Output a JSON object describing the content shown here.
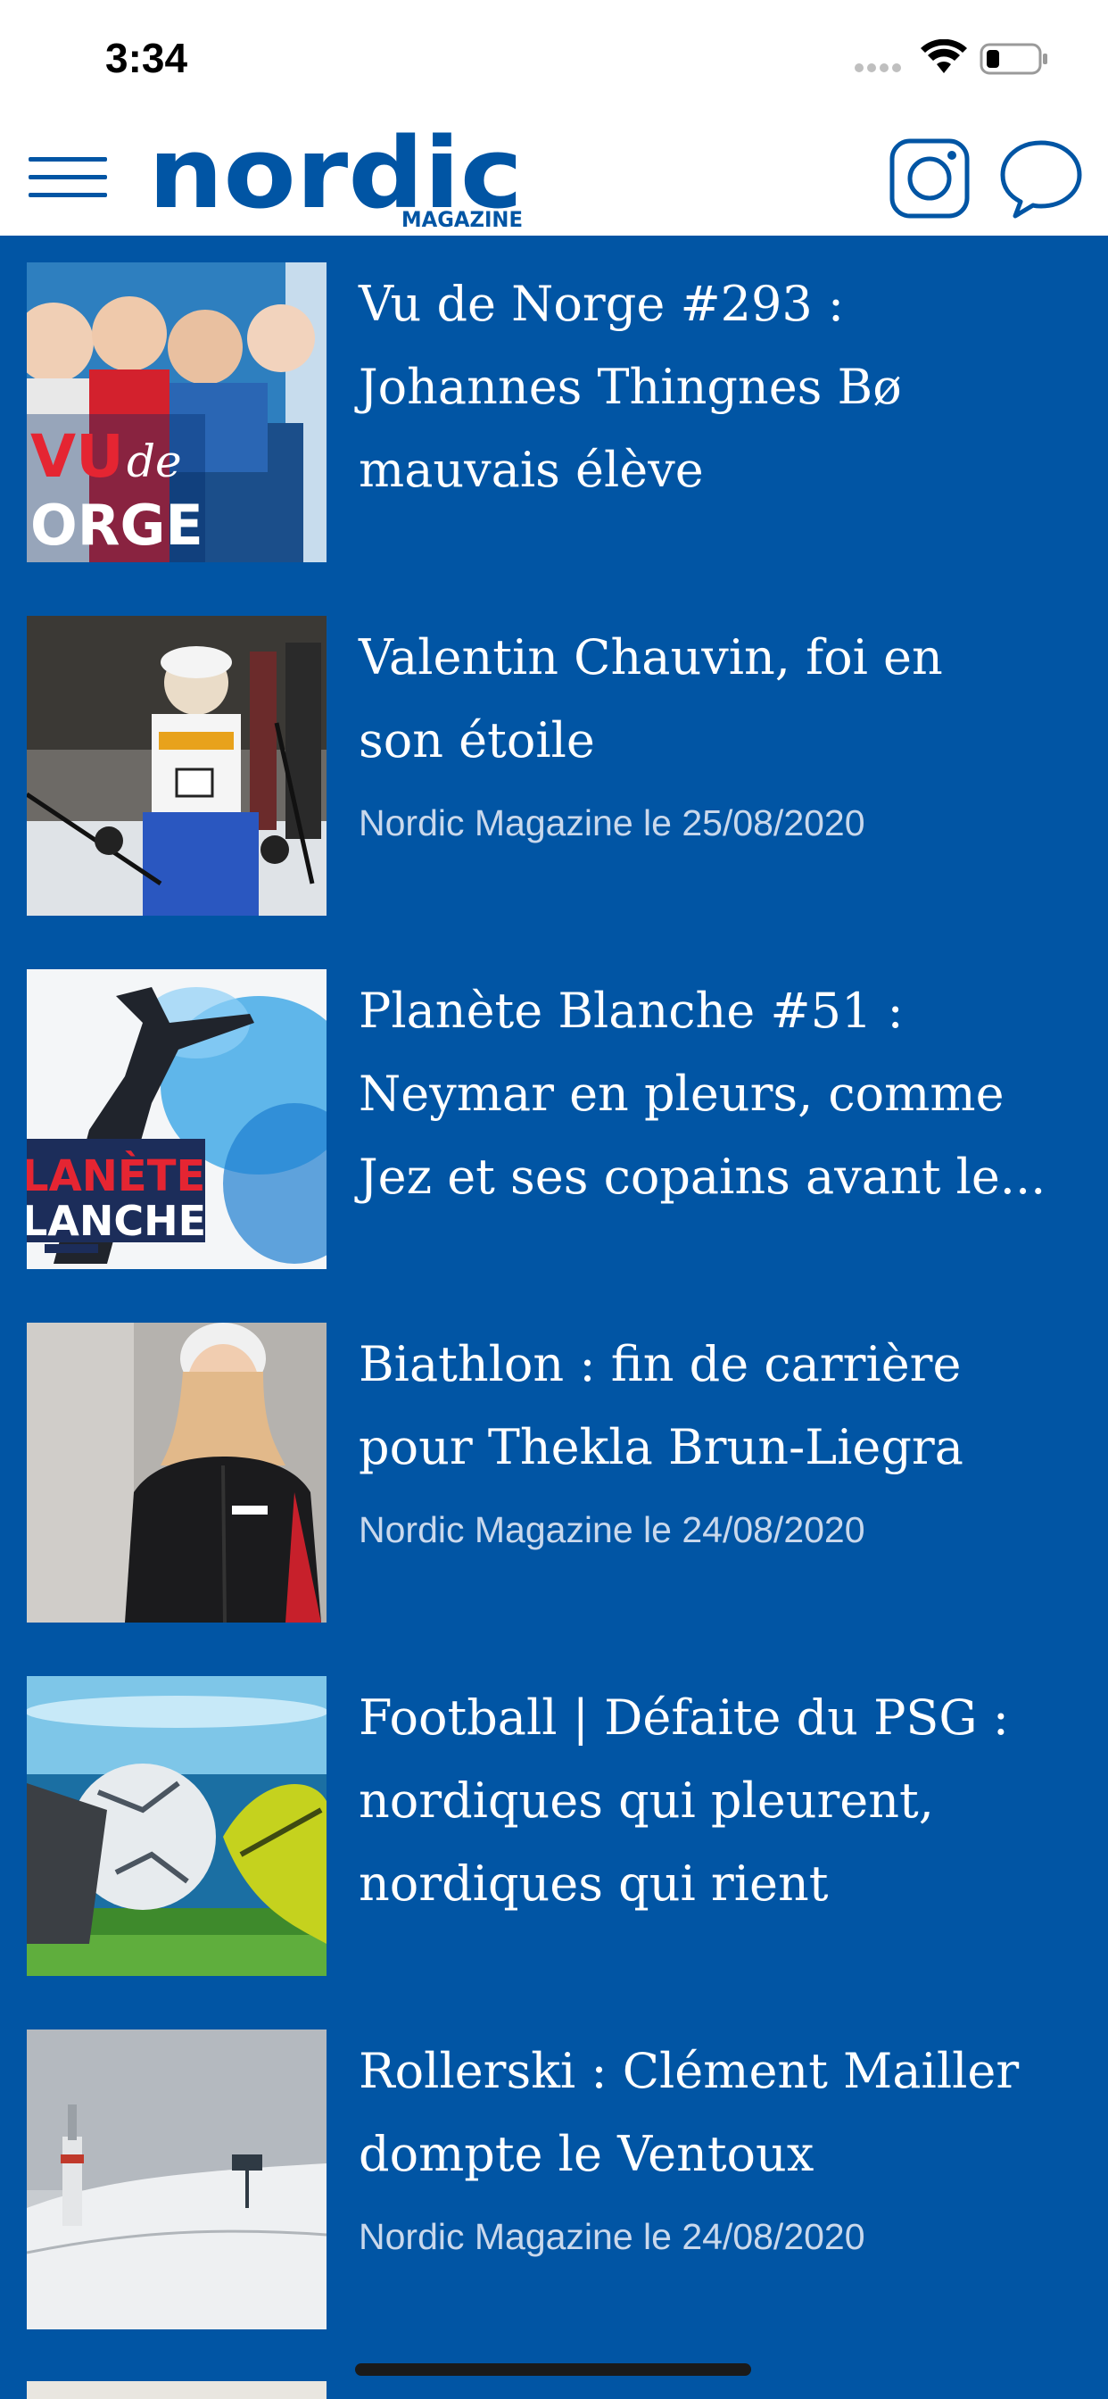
{
  "status": {
    "time": "3:34"
  },
  "header": {
    "logo_main": "nordic",
    "logo_sub": "MAGAZINE"
  },
  "colors": {
    "brand_blue": "#0155a4",
    "background": "#0155a4",
    "header_bg": "#ffffff",
    "meta_text": "#c9d8ec"
  },
  "icons": {
    "menu": "hamburger-icon",
    "instagram": "instagram-icon",
    "chat": "chat-bubble-icon"
  },
  "articles": [
    {
      "title_lines": [
        "Vu de Norge #293 :",
        "Johannes Thingnes Bø",
        "mauvais élève"
      ],
      "meta": "",
      "thumb": "vu-de-norge"
    },
    {
      "title_lines": [
        "Valentin Chauvin, foi en",
        "son étoile"
      ],
      "meta": "Nordic Magazine le 25/08/2020",
      "thumb": "skier"
    },
    {
      "title_lines": [
        "Planète Blanche #51 :",
        "Neymar en pleurs, comme",
        "Jez et ses copains avant le..."
      ],
      "meta": "",
      "thumb": "planete-blanche"
    },
    {
      "title_lines": [
        "Biathlon : fin de carrière",
        "pour Thekla Brun-Liegra"
      ],
      "meta": "Nordic Magazine le 24/08/2020",
      "thumb": "portrait"
    },
    {
      "title_lines": [
        "Football | Défaite du PSG :",
        "nordiques qui pleurent,",
        "nordiques qui rient"
      ],
      "meta": "",
      "thumb": "football"
    },
    {
      "title_lines": [
        "Rollerski : Clément Mailler",
        "dompte le Ventoux"
      ],
      "meta": "Nordic Magazine le 24/08/2020",
      "thumb": "ventoux"
    }
  ]
}
